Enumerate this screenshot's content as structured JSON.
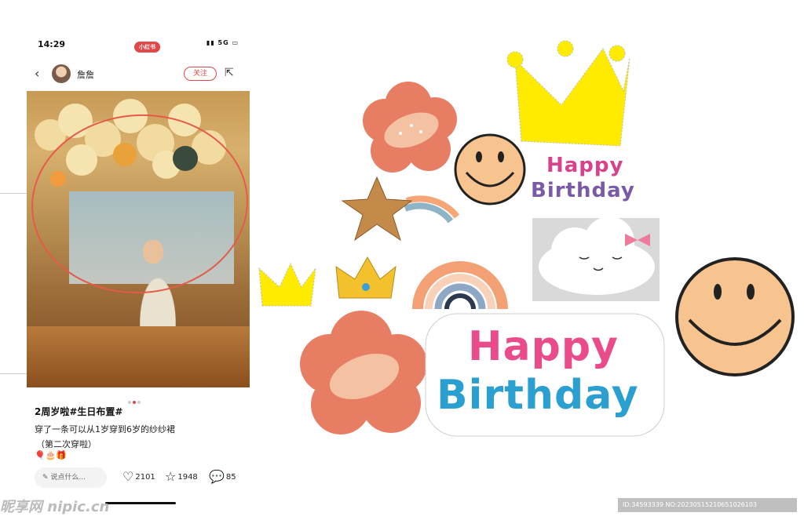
{
  "status_bar": {
    "time": "14:29",
    "right": "5G",
    "app_badge": "小红书"
  },
  "header": {
    "author": "詹詹",
    "follow_label": "关注"
  },
  "post": {
    "pager_total": 3,
    "title": "2周岁啦#生日布置#",
    "line1": "穿了一条可以从1岁穿到6岁的纱纱裙",
    "line2": "（第二次穿啦）",
    "emojis": "🎈🎂🎁"
  },
  "actions": {
    "comment_placeholder": "说点什么...",
    "likes": "2101",
    "stars": "1948",
    "comments": "85"
  },
  "stickers": {
    "happy": "Happy",
    "birthday": "Birthday",
    "happy_big": "Happy",
    "birthday_big": "Birthday"
  },
  "footer": {
    "watermark": "昵享网 nipic.cn",
    "id_text": "ID:34593339 NO:20230515210651026103"
  },
  "colors": {
    "accent": "#e2474a",
    "crown_yellow": "#ffeb00",
    "smiley_face": "#f7c38e",
    "flower": "#e77d63"
  }
}
